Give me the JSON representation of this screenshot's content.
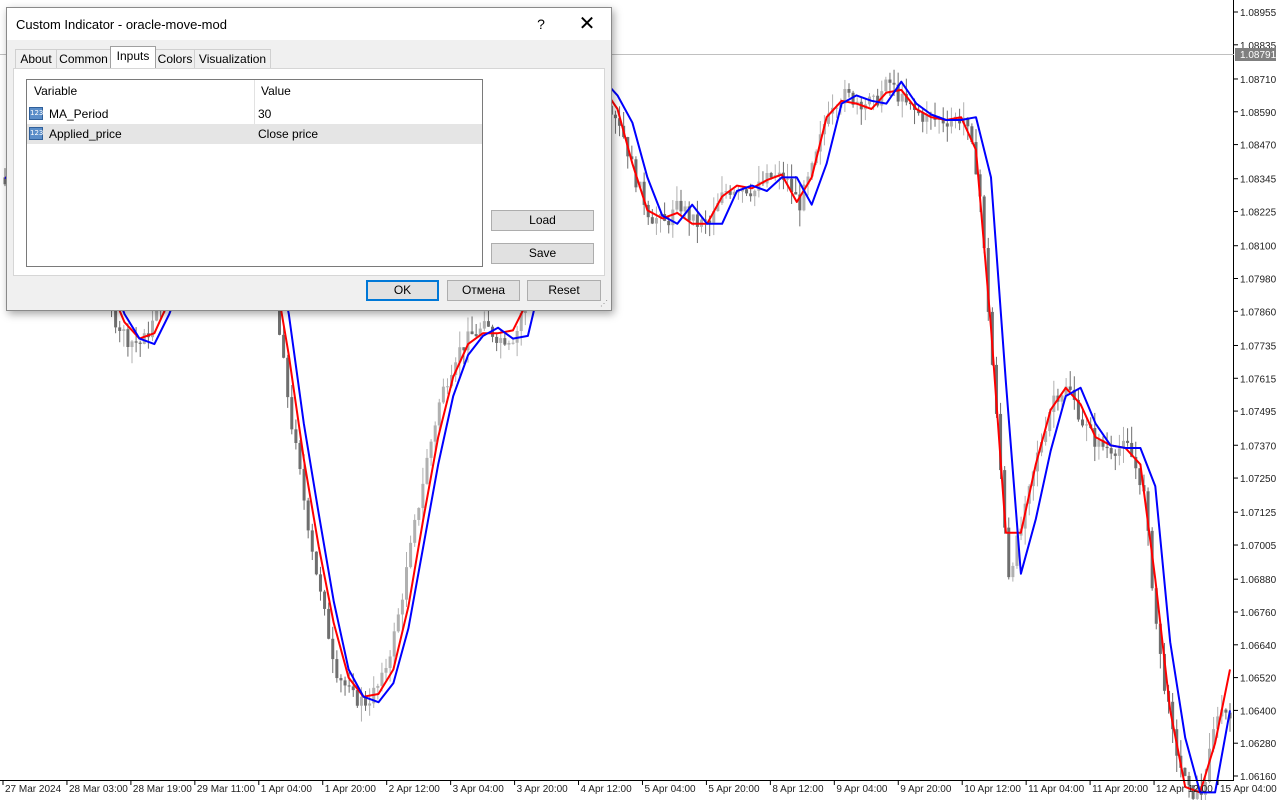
{
  "chart_data": {
    "type": "candlestick",
    "indicator_colors": {
      "fast": "#0000ff",
      "slow": "#ff0000"
    },
    "price_axis": [
      "1.08955",
      "1.08835",
      "1.08710",
      "1.08590",
      "1.08470",
      "1.08345",
      "1.08225",
      "1.08100",
      "1.07980",
      "1.07860",
      "1.07735",
      "1.07615",
      "1.07495",
      "1.07370",
      "1.07250",
      "1.07125",
      "1.07005",
      "1.06880",
      "1.06760",
      "1.06640",
      "1.06520",
      "1.06400",
      "1.06280",
      "1.06160"
    ],
    "current_price": "1.08791",
    "time_axis": [
      "27 Mar 2024",
      "28 Mar 03:00",
      "28 Mar 19:00",
      "29 Mar 11:00",
      "1 Apr 04:00",
      "1 Apr 20:00",
      "2 Apr 12:00",
      "3 Apr 04:00",
      "3 Apr 20:00",
      "4 Apr 12:00",
      "5 Apr 04:00",
      "5 Apr 20:00",
      "8 Apr 12:00",
      "9 Apr 04:00",
      "9 Apr 20:00",
      "10 Apr 12:00",
      "11 Apr 04:00",
      "11 Apr 20:00",
      "12 Apr 12:00",
      "15 Apr 04:00"
    ],
    "ma_fast": [
      1.0835,
      1.0832,
      1.083,
      1.0828,
      1.0826,
      1.0826,
      1.082,
      1.08,
      1.0785,
      1.0776,
      1.0774,
      1.0785,
      1.08,
      1.0812,
      1.0824,
      1.0828,
      1.0825,
      1.082,
      1.0812,
      1.0785,
      1.0745,
      1.0712,
      1.068,
      1.0655,
      1.0645,
      1.0643,
      1.065,
      1.067,
      1.07,
      1.073,
      1.0755,
      1.077,
      1.0777,
      1.078,
      1.0776,
      1.0777,
      1.08,
      1.0825,
      1.085,
      1.087,
      1.0871,
      1.0865,
      1.0855,
      1.0835,
      1.0821,
      1.0818,
      1.0825,
      1.0818,
      1.0818,
      1.083,
      1.0832,
      1.083,
      1.0835,
      1.0835,
      1.0825,
      1.084,
      1.0862,
      1.0865,
      1.0863,
      1.0862,
      1.087,
      1.0862,
      1.0858,
      1.0856,
      1.0856,
      1.0857,
      1.0835,
      1.076,
      1.069,
      1.071,
      1.0735,
      1.0755,
      1.0758,
      1.0745,
      1.0737,
      1.0736,
      1.0736,
      1.0722,
      1.0665,
      1.063,
      1.061,
      1.061,
      1.064
    ],
    "ma_slow": [
      1.0835,
      1.0833,
      1.083,
      1.0829,
      1.0827,
      1.0825,
      1.0815,
      1.0795,
      1.0782,
      1.0776,
      1.0778,
      1.079,
      1.0805,
      1.0817,
      1.0826,
      1.0828,
      1.0824,
      1.0818,
      1.0802,
      1.077,
      1.0732,
      1.07,
      1.0672,
      1.0652,
      1.0645,
      1.0646,
      1.0655,
      1.0678,
      1.071,
      1.074,
      1.0762,
      1.0774,
      1.0778,
      1.0778,
      1.0779,
      1.079,
      1.0818,
      1.0843,
      1.0865,
      1.0872,
      1.0868,
      1.086,
      1.084,
      1.0823,
      1.082,
      1.0822,
      1.0818,
      1.0818,
      1.0828,
      1.0832,
      1.0831,
      1.0834,
      1.0836,
      1.0826,
      1.0835,
      1.0857,
      1.0863,
      1.0862,
      1.086,
      1.0866,
      1.0867,
      1.086,
      1.0857,
      1.0856,
      1.0857,
      1.0845,
      1.078,
      1.0705,
      1.0705,
      1.073,
      1.075,
      1.0758,
      1.0752,
      1.074,
      1.0737,
      1.0736,
      1.073,
      1.0688,
      1.064,
      1.0612,
      1.061,
      1.0628,
      1.0655
    ]
  },
  "dialog": {
    "title": "Custom Indicator - oracle-move-mod",
    "help_label": "?",
    "close_label": "✕",
    "tabs": [
      {
        "label": "About",
        "active": false
      },
      {
        "label": "Common",
        "active": false
      },
      {
        "label": "Inputs",
        "active": true
      },
      {
        "label": "Colors",
        "active": false
      },
      {
        "label": "Visualization",
        "active": false
      }
    ],
    "inputs_table": {
      "headers": [
        "Variable",
        "Value"
      ],
      "type_icon": "123",
      "rows": [
        {
          "variable": "MA_Period",
          "value": "30",
          "icon": "integer-type-icon",
          "selected": false
        },
        {
          "variable": "Applied_price",
          "value": "Close price",
          "icon": "integer-type-icon",
          "selected": true
        }
      ]
    },
    "load_label": "Load",
    "save_label": "Save",
    "ok_label": "OK",
    "cancel_label": "Отмена",
    "reset_label": "Reset"
  }
}
